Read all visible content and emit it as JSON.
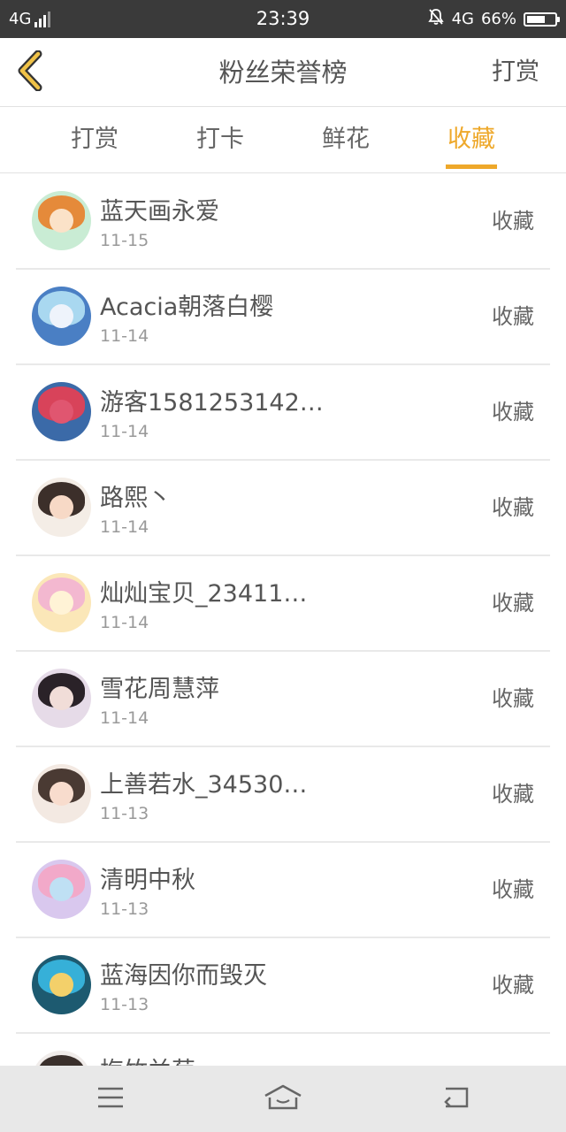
{
  "status_bar": {
    "network_left": "4G",
    "time": "23:39",
    "network_right": "4G",
    "battery": "66%",
    "battery_level": 0.66
  },
  "header": {
    "title": "粉丝荣誉榜",
    "action_label": "打赏"
  },
  "tabs": [
    {
      "label": "打赏",
      "active": false
    },
    {
      "label": "打卡",
      "active": false
    },
    {
      "label": "鲜花",
      "active": false
    },
    {
      "label": "收藏",
      "active": true
    }
  ],
  "accent_color": "#eea82a",
  "list": {
    "items": [
      {
        "name": "蓝天画永爱",
        "date": "11-15",
        "action": "收藏"
      },
      {
        "name": "Acacia朝落白樱",
        "date": "11-14",
        "action": "收藏"
      },
      {
        "name": "游客1581253142…",
        "date": "11-14",
        "action": "收藏"
      },
      {
        "name": "路熙丶",
        "date": "11-14",
        "action": "收藏"
      },
      {
        "name": "灿灿宝贝_23411…",
        "date": "11-14",
        "action": "收藏"
      },
      {
        "name": "雪花周慧萍",
        "date": "11-14",
        "action": "收藏"
      },
      {
        "name": "上善若水_34530…",
        "date": "11-13",
        "action": "收藏"
      },
      {
        "name": "清明中秋",
        "date": "11-13",
        "action": "收藏"
      },
      {
        "name": "蓝海因你而毁灭",
        "date": "11-13",
        "action": "收藏"
      },
      {
        "name": "梅竹兰菊",
        "date": "",
        "action": ""
      }
    ]
  },
  "bottom_nav": {
    "icons": [
      "menu-icon",
      "home-icon",
      "back-icon"
    ]
  }
}
